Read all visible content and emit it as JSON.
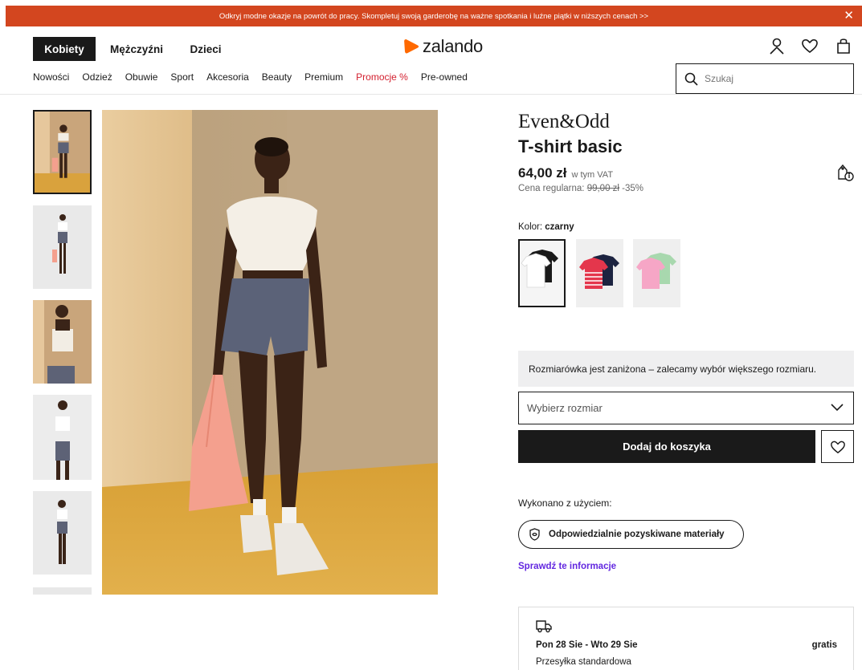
{
  "promo": {
    "text": "Odkryj modne okazje na powrót do pracy. Skompletuj swoją garderobę na ważne spotkania i luźne piątki w niższych cenach >>",
    "close": "✕"
  },
  "header": {
    "gender_tabs": [
      {
        "label": "Kobiety",
        "active": true
      },
      {
        "label": "Mężczyźni",
        "active": false
      },
      {
        "label": "Dzieci",
        "active": false
      }
    ],
    "logo_text": "zalando",
    "icons": [
      "user-icon",
      "heart-icon",
      "bag-icon"
    ]
  },
  "categories": [
    {
      "label": "Nowości"
    },
    {
      "label": "Odzież"
    },
    {
      "label": "Obuwie"
    },
    {
      "label": "Sport"
    },
    {
      "label": "Akcesoria"
    },
    {
      "label": "Beauty"
    },
    {
      "label": "Premium"
    },
    {
      "label": "Promocje %",
      "promo": true
    },
    {
      "label": "Pre-owned"
    }
  ],
  "search": {
    "placeholder": "Szukaj"
  },
  "gallery": {
    "thumbnails": [
      "full-front",
      "full-front-2",
      "upper-body",
      "front-walk",
      "back-view",
      "partial"
    ],
    "active_index": 0
  },
  "product": {
    "brand": "Even&Odd",
    "name": "T-shirt basic",
    "price": "64,00 zł",
    "vat": "w tym VAT",
    "regular_label": "Cena regularna:",
    "regular_price": "99,00 zł",
    "discount": "-35%",
    "color_label": "Kolor:",
    "color_value": "czarny",
    "swatches": [
      {
        "name": "white-black",
        "active": true
      },
      {
        "name": "pink-stripe-navy",
        "active": false
      },
      {
        "name": "pink-green",
        "active": false
      }
    ],
    "size_note": "Rozmiarówka jest zaniżona – zalecamy wybór większego rozmiaru.",
    "size_placeholder": "Wybierz rozmiar",
    "add_to_cart": "Dodaj do koszyka",
    "made_with": "Wykonano z użyciem:",
    "material": "Odpowiedzialnie pozyskiwane materiały",
    "check_info": "Sprawdź te informacje"
  },
  "delivery": {
    "date": "Pon 28 Sie - Wto 29 Sie",
    "price": "gratis",
    "type": "Przesyłka standardowa"
  },
  "colors": {
    "accent": "#d3461f",
    "promo_text": "#d3202f",
    "link": "#6328e0",
    "dark": "#1a1a1a"
  }
}
